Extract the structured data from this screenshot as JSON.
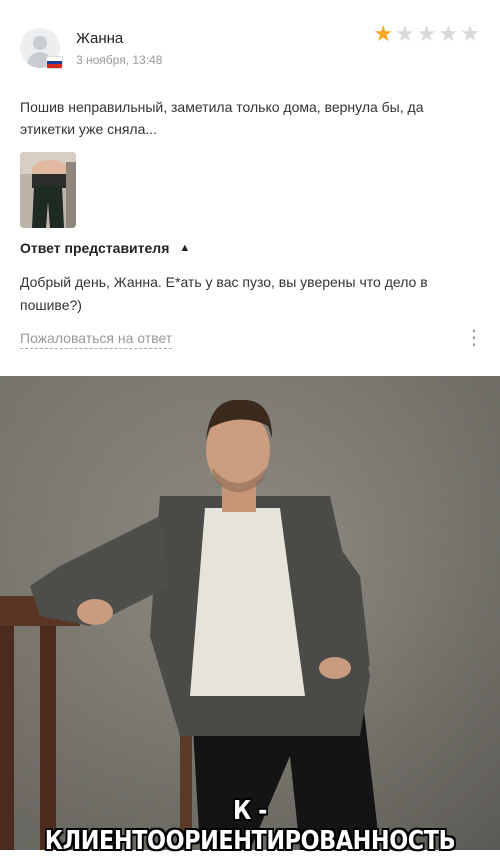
{
  "review": {
    "author": "Жанна",
    "date": "3 ноября, 13:48",
    "rating": 1,
    "rating_max": 5,
    "text": "Пошив неправильный, заметила только дома, вернула бы, да этикетки уже сняла...",
    "flag_colors": [
      "#ffffff",
      "#1c3f9f",
      "#d52b1e"
    ]
  },
  "response": {
    "heading": "Ответ представителя",
    "text": "Добрый день, Жанна. Е*ать у вас пузо, вы уверены что дело в пошиве?)",
    "complain_link": "Пожаловаться на ответ"
  },
  "meme": {
    "caption": "К - КЛИЕНТООРИЕНТИРОВАННОСТЬ"
  },
  "icons": {
    "star": "★",
    "collapse": "chevron-up-icon",
    "more": "more-vertical-icon"
  },
  "colors": {
    "star_active": "#f5a623",
    "star_inactive": "#d9d9d9"
  }
}
